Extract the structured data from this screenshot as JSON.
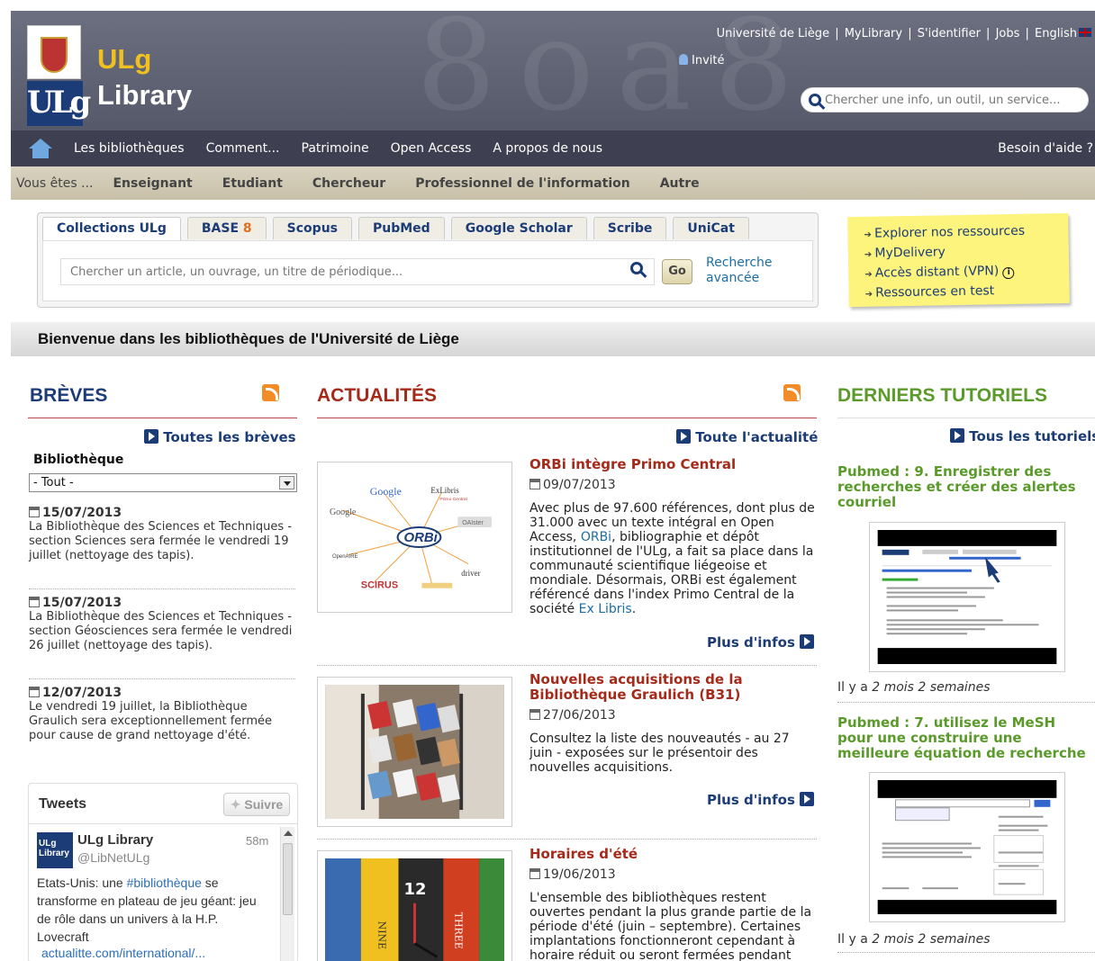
{
  "header": {
    "logo_line1": "ULg",
    "logo_line2": "Library",
    "toplinks": [
      "Université de Liège",
      "MyLibrary",
      "S'identifier",
      "Jobs",
      "English"
    ],
    "guest": "Invité",
    "search_placeholder": "Chercher une info, un outil, un service..."
  },
  "mainnav": {
    "items": [
      "Les bibliothèques",
      "Comment...",
      "Patrimoine",
      "Open Access",
      "A propos de nous"
    ],
    "help": "Besoin d'aide ?"
  },
  "audnav": {
    "label": "Vous êtes ...",
    "items": [
      "Enseignant",
      "Etudiant",
      "Chercheur",
      "Professionnel de l'information",
      "Autre"
    ]
  },
  "search": {
    "tabs": [
      "Collections ULg",
      "BASE",
      "Scopus",
      "PubMed",
      "Google Scholar",
      "Scribe",
      "UniCat"
    ],
    "base_suffix": "8",
    "placeholder": "Chercher un article, un ouvrage, un titre de périodique...",
    "go": "Go",
    "advanced_1": "Recherche",
    "advanced_2": "avancée"
  },
  "sticky": [
    "Explorer nos ressources",
    "MyDelivery",
    "Accès distant (VPN)",
    "Ressources en test"
  ],
  "welcome": "Bienvenue dans les bibliothèques de l'Université de Liège",
  "breves": {
    "title": "BRÈVES",
    "all": "Toutes les brèves",
    "filter_label": "Bibliothèque",
    "filter_value": "- Tout -",
    "items": [
      {
        "date": "15/07/2013",
        "text": "La Bibliothèque des Sciences et Techniques - section Sciences sera fermée le vendredi 19 juillet (nettoyage des tapis)."
      },
      {
        "date": "15/07/2013",
        "text": "La Bibliothèque des Sciences et Techniques - section Géosciences sera fermée le vendredi 26 juillet (nettoyage des tapis)."
      },
      {
        "date": "12/07/2013",
        "text": "Le vendredi 19 juillet, la Bibliothèque Graulich sera exceptionnellement fermée pour cause de grand nettoyage d'été."
      }
    ]
  },
  "tweets": {
    "title": "Tweets",
    "follow": "Suivre",
    "avatar_line1": "ULg",
    "avatar_line2": "Library",
    "name": "ULg Library",
    "handle": "@LibNetULg",
    "time": "58m",
    "text_before": "Etats-Unis: une ",
    "hashtag": "#bibliothèque",
    "text_after": " se transforme en plateau de jeu géant: jeu de rôle dans un univers à la H.P. Lovecraft",
    "link": "actualitte.com/international/..."
  },
  "actualites": {
    "title": "ACTUALITÉS",
    "all": "Toute l'actualité",
    "more": "Plus d'infos",
    "items": [
      {
        "title": "ORBi intègre Primo Central",
        "date": "09/07/2013",
        "body_1": "Avec plus de 97.600 références, dont plus de 31.000 avec un texte intégral en Open Access, ",
        "link_1": "ORBi",
        "body_2": ", bibliographie et dépôt institutionnel de l'ULg, a fait sa place dans la communauté scientifique liégeoise et mondiale. Désormais, ORBi est également référencé dans l'index Primo Central de la société ",
        "link_2": "Ex Libris",
        "body_3": "."
      },
      {
        "title": "Nouvelles acquisitions de la Bibliothèque Graulich (B31)",
        "date": "27/06/2013",
        "body_1": "Consultez la liste des nouveautés - au 27 juin - exposées sur le présentoir des nouvelles acquisitions."
      },
      {
        "title": "Horaires d'été",
        "date": "19/06/2013",
        "body_1": "L'ensemble des bibliothèques restent ouvertes pendant la plus grande partie de la période d'été (juin – septembre). Certaines implantations fonctionneront cependant à horaire réduit ou seront fermées pendant"
      }
    ],
    "orbi_logos": [
      "Google",
      "ExLibris",
      "Primo Central",
      "ORBi",
      "OAIster",
      "OpenAIRE",
      "driver",
      "SCIRUS"
    ]
  },
  "tutoriels": {
    "title": "DERNIERS TUTORIELS",
    "all": "Tous les tutoriels",
    "items": [
      {
        "title": "Pubmed : 9. Enregistrer des recherches et créer des alertes courriel",
        "ago_prefix": "Il y a ",
        "ago": "2 mois 2 semaines"
      },
      {
        "title": "Pubmed : 7. utilisez le MeSH pour une construire une meilleure équation de recherche",
        "ago_prefix": "Il y a ",
        "ago": "2 mois 2 semaines"
      }
    ]
  },
  "colors": {
    "nav": "#3e4051",
    "brand_blue": "#1c3c78",
    "news_red": "#a52a1a",
    "tut_green": "#5a9a2a",
    "sticky": "#fcf47c"
  }
}
